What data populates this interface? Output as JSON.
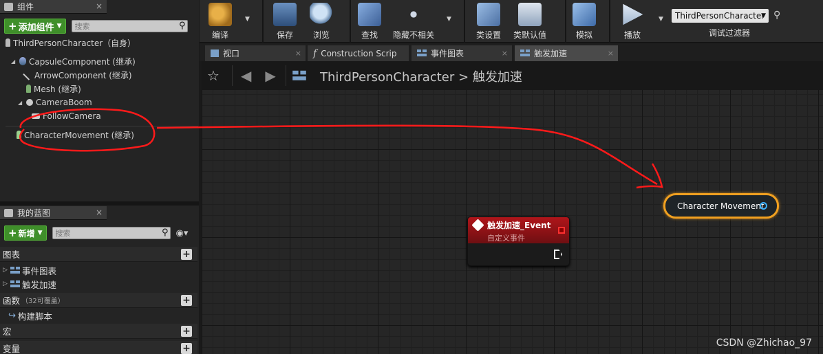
{
  "components_panel": {
    "tab_label": "组件",
    "add_button": "添加组件",
    "search_placeholder": "搜索",
    "root": "ThirdPersonCharacter（自身）",
    "items": [
      {
        "label": "CapsuleComponent (继承)",
        "icon": "capsule-icon"
      },
      {
        "label": "ArrowComponent (继承)",
        "icon": "arrow-icon"
      },
      {
        "label": "Mesh (继承)",
        "icon": "person-icon"
      },
      {
        "label": "CameraBoom",
        "icon": "spring-arm-icon"
      },
      {
        "label": "FollowCamera",
        "icon": "camera-icon"
      },
      {
        "label": "CharacterMovement (继承)",
        "icon": "movement-icon"
      }
    ]
  },
  "blueprint_panel": {
    "tab_label": "我的蓝图",
    "new_button": "新增",
    "search_placeholder": "搜索",
    "sections": {
      "graphs": "图表",
      "graph_items": [
        "事件图表",
        "触发加速"
      ],
      "functions": "函数",
      "functions_note": "（32可覆盖）",
      "construction_script": "构建脚本",
      "macros": "宏",
      "variables": "变量"
    }
  },
  "toolbar": {
    "compile": "编译",
    "save": "保存",
    "browse": "浏览",
    "find": "查找",
    "hide_unrelated": "隐藏不相关",
    "class_settings": "类设置",
    "class_defaults": "类默认值",
    "simulate": "模拟",
    "play": "播放",
    "debug_selected": "ThirdPersonCharacter",
    "debug_filter": "调试过滤器"
  },
  "doc_tabs": [
    {
      "label": "视口",
      "icon": "viewport-icon"
    },
    {
      "label": "Construction Scrip",
      "icon": "function-icon"
    },
    {
      "label": "事件图表",
      "icon": "graph-icon"
    },
    {
      "label": "触发加速",
      "icon": "graph-icon"
    }
  ],
  "breadcrumb": {
    "root": "ThirdPersonCharacter",
    "separator": ">",
    "current": "触发加速"
  },
  "event_node": {
    "title": "触发加速_Event",
    "subtitle": "自定义事件"
  },
  "variable_node": {
    "label": "Character Movement"
  },
  "watermark": "CSDN @Zhichao_97",
  "colors": {
    "accent_green": "#3f8f2a",
    "event_red": "#b0151a",
    "variable_border": "#f0a020",
    "annotation_red": "#ff1a1a"
  }
}
